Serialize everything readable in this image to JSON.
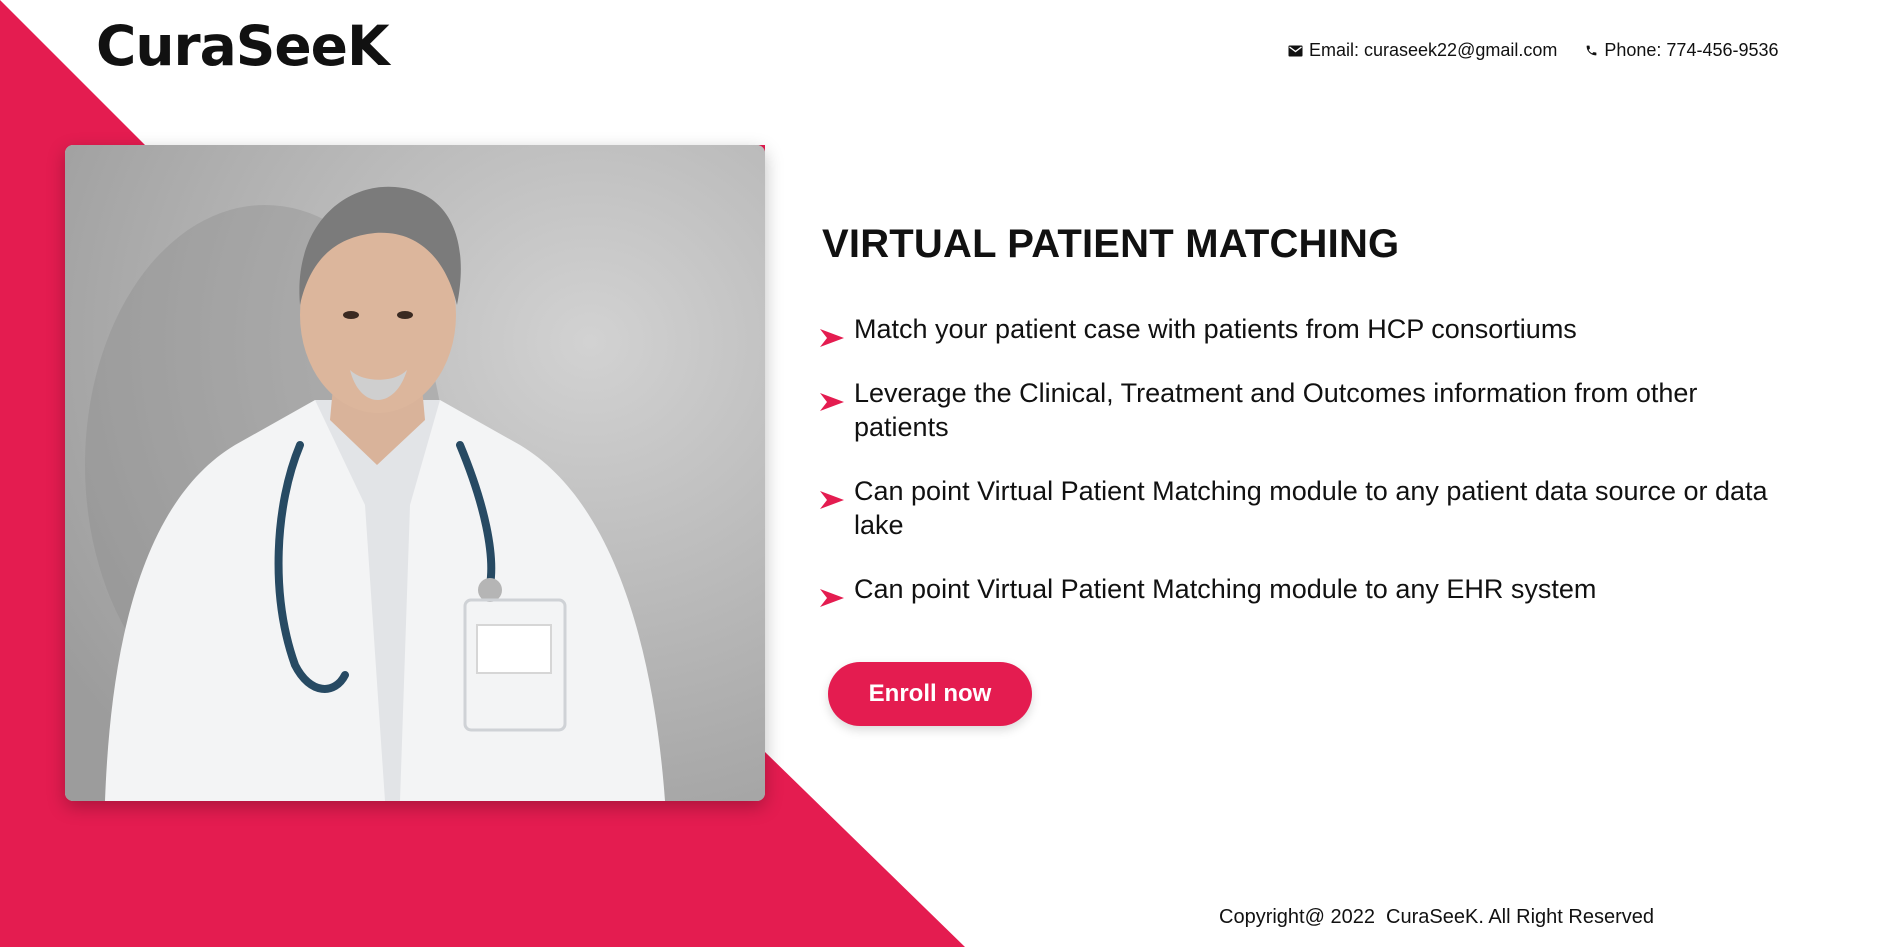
{
  "brand": {
    "logo": "CuraSeeK",
    "accent_color": "#e41c50"
  },
  "contact": {
    "email": "Email: curaseek22@gmail.com",
    "phone": "Phone: 774-456-9536",
    "email_icon": "envelope-icon",
    "phone_icon": "phone-icon"
  },
  "hero": {
    "image": "doctor-photo",
    "title": "VIRTUAL PATIENT MATCHING",
    "features": [
      "Match your patient case with patients from HCP consortiums",
      "Leverage the Clinical, Treatment and Outcomes information from other patients",
      "Can point Virtual Patient Matching module to any patient data source or data lake",
      "Can point Virtual Patient Matching module to any EHR system"
    ],
    "bullet_icon": "arrow-right-icon",
    "cta_label": "Enroll now"
  },
  "footer": {
    "copyright": "Copyright@ 2022  CuraSeeK. All Right Reserved"
  }
}
